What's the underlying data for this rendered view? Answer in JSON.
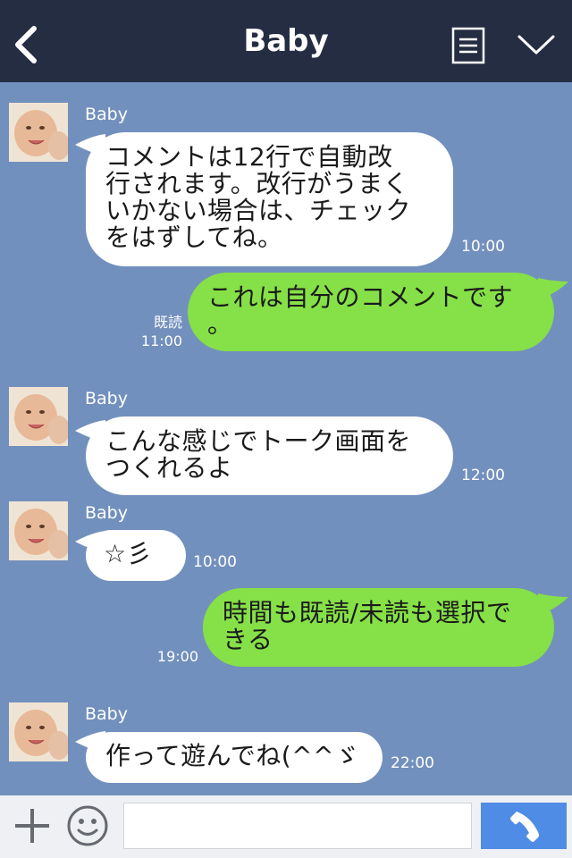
{
  "header": {
    "title": "Baby",
    "back_icon": "chevron-left-icon",
    "menu_icon": "menu-list-icon",
    "expand_icon": "chevron-down-icon"
  },
  "messages": [
    {
      "side": "in",
      "sender": "Baby",
      "text": "コメントは12行で自動改\n行されます。改行がうまく\nいかない場合は、チェック\nをはずしてね。",
      "time": "10:00"
    },
    {
      "side": "out",
      "text": "これは自分のコメントです\n。",
      "read": "既読",
      "time": "11:00"
    },
    {
      "side": "in",
      "sender": "Baby",
      "text": "こんな感じでトーク画面を\nつくれるよ",
      "time": "12:00"
    },
    {
      "side": "in",
      "sender": "Baby",
      "text": "☆彡",
      "time": "10:00"
    },
    {
      "side": "out",
      "text": "時間も既読/未読も選択で\nきる",
      "read": "",
      "time": "19:00"
    },
    {
      "side": "in",
      "sender": "Baby",
      "text": "作って遊んでね(^^ゞ",
      "time": "22:00"
    }
  ],
  "footer": {
    "plus_icon": "plus-icon",
    "sticker_icon": "smiley-icon",
    "input_value": "",
    "input_placeholder": "",
    "call_icon": "phone-icon"
  },
  "colors": {
    "background": "#7290bd",
    "header": "#242d42",
    "incoming_bubble": "#ffffff",
    "outgoing_bubble": "#86e047",
    "call_button": "#4f8ce5"
  }
}
